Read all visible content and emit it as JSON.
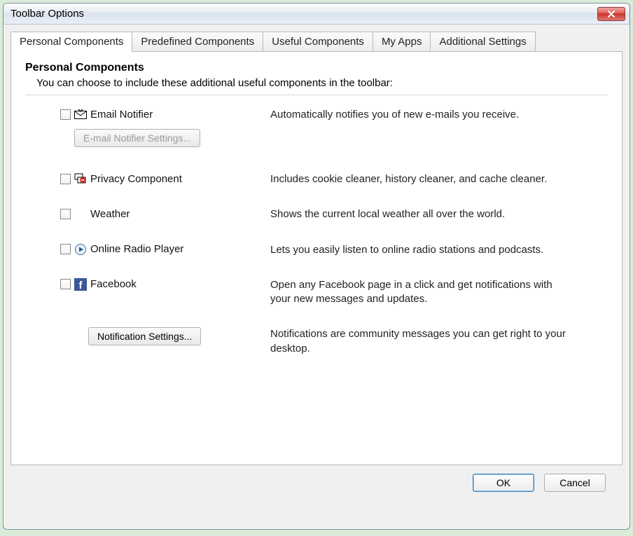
{
  "window": {
    "title": "Toolbar Options"
  },
  "tabs": [
    {
      "label": "Personal Components",
      "active": true
    },
    {
      "label": "Predefined Components",
      "active": false
    },
    {
      "label": "Useful Components",
      "active": false
    },
    {
      "label": "My Apps",
      "active": false
    },
    {
      "label": "Additional Settings",
      "active": false
    }
  ],
  "panel": {
    "title": "Personal Components",
    "subtitle": "You can choose to include these additional useful components in the toolbar:"
  },
  "components": {
    "email": {
      "label": "Email Notifier",
      "desc": "Automatically notifies you of new e-mails you receive.",
      "settings_btn": "E-mail Notifier Settings...",
      "icon": "envelope-icon"
    },
    "privacy": {
      "label": "Privacy Component",
      "desc": "Includes cookie cleaner, history cleaner, and cache cleaner.",
      "icon": "privacy-icon"
    },
    "weather": {
      "label": "Weather",
      "desc": "Shows the current local weather all over the world.",
      "icon": ""
    },
    "radio": {
      "label": "Online Radio Player",
      "desc": "Lets you easily listen to online radio stations and podcasts.",
      "icon": "play-circle-icon"
    },
    "facebook": {
      "label": "Facebook",
      "desc": "Open any Facebook page in a click and get notifications with your new messages and updates.",
      "icon": "facebook-icon"
    },
    "notifications": {
      "btn": "Notification Settings...",
      "desc": "Notifications are community messages you can get right to your desktop."
    }
  },
  "buttons": {
    "ok": "OK",
    "cancel": "Cancel"
  }
}
